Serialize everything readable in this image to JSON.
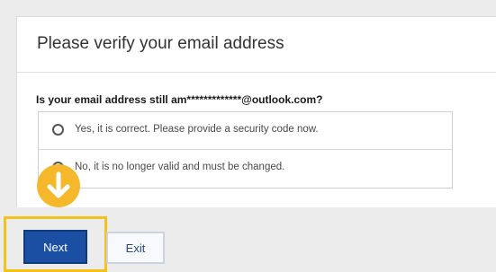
{
  "dialog": {
    "title": "Please verify your email address",
    "question": "Is your email address still am*************@outlook.com?",
    "options": [
      {
        "label": "Yes, it is correct. Please provide a security code now.",
        "selected": false
      },
      {
        "label": "No, it is no longer valid and must be changed.",
        "selected": false
      }
    ]
  },
  "buttons": {
    "next_label": "Next",
    "exit_label": "Exit"
  },
  "annotation": {
    "icon": "arrow-down-icon",
    "color": "#f5b82a",
    "highlight_color": "#f5c21b"
  },
  "colors": {
    "primary_button": "#1a4fa3",
    "page_background": "#ececec"
  }
}
